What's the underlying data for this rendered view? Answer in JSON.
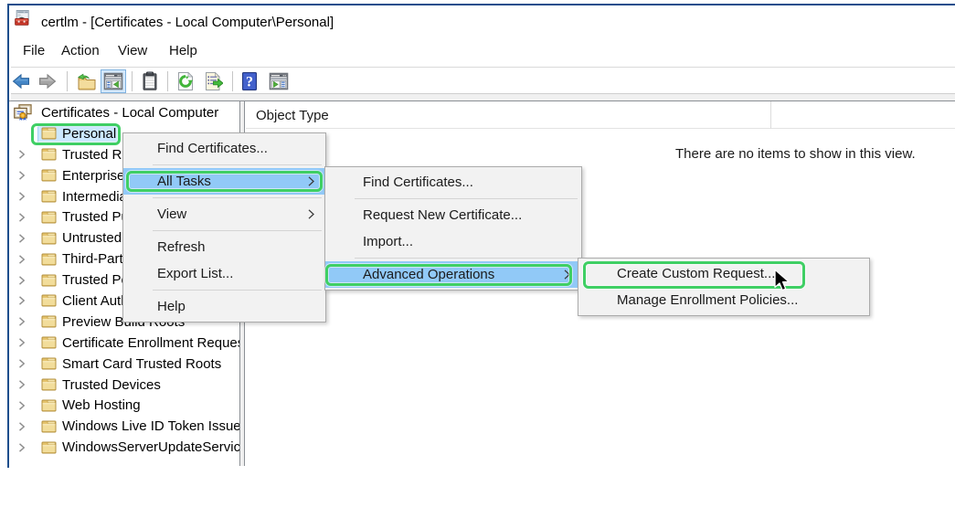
{
  "colors": {
    "window_border": "#1e4e8c",
    "annotation_green": "#3fcf64",
    "menu_highlight": "#91c9f7",
    "tree_selection": "#cce8ff",
    "toolbar_active_bg": "#d3e8fb",
    "toolbar_active_border": "#7fb2e0"
  },
  "window": {
    "title": "certlm - [Certificates - Local Computer\\Personal]",
    "icon": "certlm-app-icon"
  },
  "menubar": {
    "items": [
      {
        "label": "File"
      },
      {
        "label": "Action"
      },
      {
        "label": "View"
      },
      {
        "label": "Help"
      }
    ]
  },
  "toolbar": {
    "buttons": [
      {
        "icon": "back-arrow-icon"
      },
      {
        "icon": "forward-arrow-icon"
      },
      {
        "icon": "up-one-level-icon"
      },
      {
        "icon": "show-console-tree-icon",
        "active": true
      },
      {
        "icon": "clipboard-icon"
      },
      {
        "icon": "refresh-icon"
      },
      {
        "icon": "export-list-icon"
      },
      {
        "icon": "help-icon"
      },
      {
        "icon": "show-action-pane-icon"
      }
    ]
  },
  "tree": {
    "root": {
      "label": "Certificates - Local Computer",
      "icon": "certificates-snapin-icon"
    },
    "items": [
      {
        "label": "Personal",
        "selected": true,
        "chevron": false,
        "annotated": true
      },
      {
        "label": "Trusted Root Certification Authorities",
        "chevron": true
      },
      {
        "label": "Enterprise Trust",
        "chevron": true
      },
      {
        "label": "Intermediate Certification Authorities",
        "chevron": true
      },
      {
        "label": "Trusted Publishers",
        "chevron": true
      },
      {
        "label": "Untrusted Certificates",
        "chevron": true
      },
      {
        "label": "Third-Party Root Certification Authorities",
        "chevron": true
      },
      {
        "label": "Trusted People",
        "chevron": true
      },
      {
        "label": "Client Authentication Issuers",
        "chevron": true
      },
      {
        "label": "Preview Build Roots",
        "chevron": true
      },
      {
        "label": "Certificate Enrollment Requests",
        "chevron": true
      },
      {
        "label": "Smart Card Trusted Roots",
        "chevron": true
      },
      {
        "label": "Trusted Devices",
        "chevron": true
      },
      {
        "label": "Web Hosting",
        "chevron": true
      },
      {
        "label": "Windows Live ID Token Issuer",
        "chevron": true
      },
      {
        "label": "WindowsServerUpdateServices",
        "chevron": true
      }
    ]
  },
  "list": {
    "column_header": "Object Type",
    "empty_message": "There are no items to show in this view."
  },
  "context_menu": {
    "items": [
      {
        "label": "Find Certificates..."
      },
      {
        "separator": true
      },
      {
        "label": "All Tasks",
        "submenu": true,
        "highlighted": true,
        "annotated": true
      },
      {
        "separator": true
      },
      {
        "label": "View",
        "submenu": true
      },
      {
        "separator": true
      },
      {
        "label": "Refresh"
      },
      {
        "label": "Export List..."
      },
      {
        "separator": true
      },
      {
        "label": "Help"
      }
    ]
  },
  "all_tasks_submenu": {
    "items": [
      {
        "label": "Find Certificates..."
      },
      {
        "separator": true
      },
      {
        "label": "Request New Certificate..."
      },
      {
        "label": "Import..."
      },
      {
        "separator": true
      },
      {
        "label": "Advanced Operations",
        "submenu": true,
        "highlighted": true,
        "annotated": true
      }
    ]
  },
  "advanced_operations_submenu": {
    "items": [
      {
        "label": "Create Custom Request...",
        "annotated": true
      },
      {
        "label": "Manage Enrollment Policies..."
      }
    ]
  },
  "cursor": {
    "icon": "arrow-cursor-icon"
  }
}
